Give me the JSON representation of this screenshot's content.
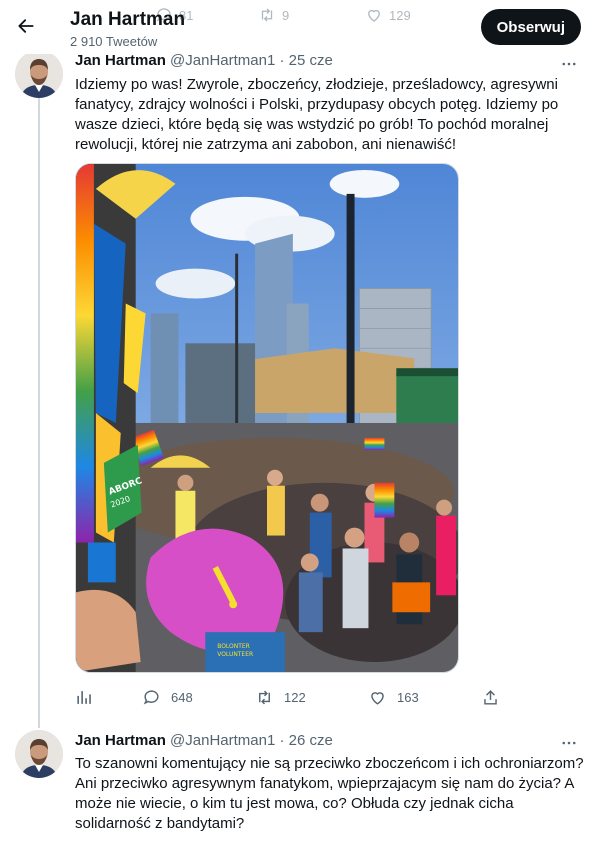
{
  "header": {
    "title": "Jan Hartman",
    "subtitle": "2 910 Tweetów",
    "follow_label": "Obserwuj",
    "ghost_counts": {
      "replies": "81",
      "retweets": "9",
      "likes": "129"
    }
  },
  "tweets": [
    {
      "name": "Jan Hartman",
      "handle": "@JanHartman1",
      "dot": "·",
      "date": "25 cze",
      "text": "Idziemy po was! Zwyrole, zboczeńcy, złodzieje, prześladowcy, agresywni fanatycy, zdrajcy wolności i Polski, przydupasy obcych potęg. Idziemy po wasze dzieci, które będą się was wstydzić po grób! To pochód moralnej rewolucji, której nie zatrzyma ani zabobon, ani nienawiść!",
      "actions": {
        "replies": "648",
        "retweets": "122",
        "likes": "163"
      },
      "media_sign_text": [
        "ABORC",
        "2020"
      ],
      "umbrella_text": [
        "BOLONTER",
        "VOLUNTEER"
      ]
    },
    {
      "name": "Jan Hartman",
      "handle": "@JanHartman1",
      "dot": "·",
      "date": "26 cze",
      "text": "To szanowni komentujący nie są przeciwko zboczeńcom i ich ochroniarzom? Ani przeciwko agresywnym fanatykom, wpieprzajacym się nam do życia? A może nie wiecie, o kim tu jest mowa, co? Obłuda czy jednak cicha solidarność z bandytami?"
    }
  ],
  "icons": {
    "back": "arrow-left-icon",
    "more": "more-dots-icon",
    "analytics": "analytics-icon",
    "reply": "reply-icon",
    "retweet": "retweet-icon",
    "like": "heart-icon",
    "share": "share-icon"
  },
  "colors": {
    "text": "#0f1419",
    "secondary": "#536471",
    "button_bg": "#0f1419",
    "thread_line": "#cfd9de"
  }
}
